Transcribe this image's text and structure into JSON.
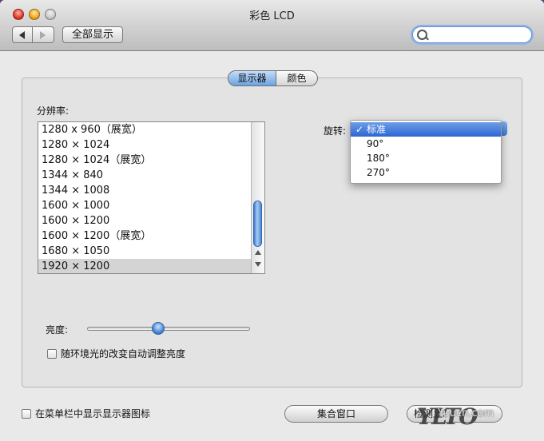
{
  "window": {
    "title": "彩色 LCD"
  },
  "toolbar": {
    "show_all_label": "全部显示",
    "search_placeholder": ""
  },
  "tabs": [
    {
      "label": "显示器",
      "active": true
    },
    {
      "label": "颜色",
      "active": false
    }
  ],
  "resolution": {
    "label": "分辨率:",
    "items": [
      "1280 x 960（展宽）",
      "1280 × 1024",
      "1280 × 1024（展宽）",
      "1344 × 840",
      "1344 × 1008",
      "1600 × 1000",
      "1600 × 1200",
      "1600 × 1200（展宽）",
      "1680 × 1050",
      "1920 × 1200"
    ],
    "selected_index": 9
  },
  "rotation": {
    "label": "旋转:",
    "options": [
      "标准",
      "90°",
      "180°",
      "270°"
    ],
    "selected": "标准"
  },
  "brightness": {
    "label": "亮度:",
    "level": 0.43
  },
  "auto_brightness": {
    "label": "随环境光的改变自动调整亮度",
    "checked": false
  },
  "footer": {
    "menu_checkbox_label": "在菜单栏中显示显示器图标",
    "gather_button": "集合窗口",
    "detect_button": "检测显示器"
  },
  "watermark": {
    "text": "Yuucn.com",
    "logo": "YLTO"
  },
  "colors": {
    "accent": "#3d7ad4",
    "selection": "#d4d4d4"
  }
}
